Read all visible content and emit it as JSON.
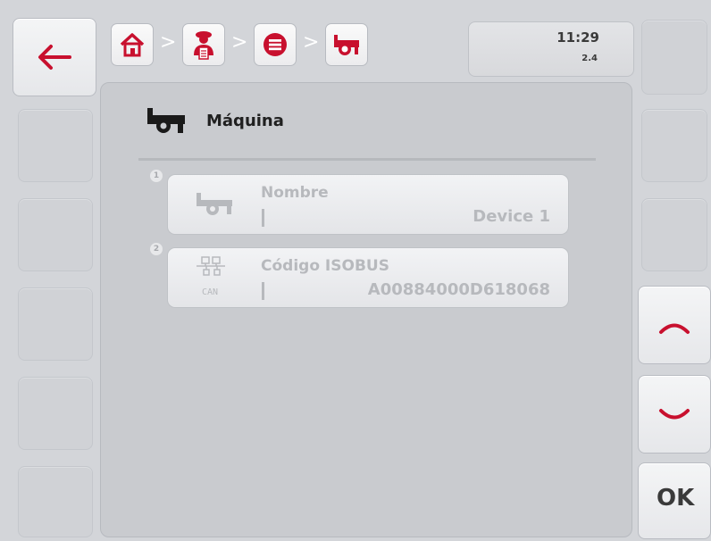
{
  "header": {
    "breadcrumbs": [
      "home-icon",
      "operator-icon",
      "list-icon",
      "machine-icon"
    ],
    "separator": ">",
    "time": "11:29",
    "version": "2.4"
  },
  "page": {
    "title": "Máquina",
    "title_icon": "machine-icon"
  },
  "fields": [
    {
      "number": "1",
      "label": "Nombre",
      "value": "Device 1",
      "icon": "machine-icon"
    },
    {
      "number": "2",
      "label": "Código ISOBUS",
      "value": "A00884000D618068",
      "icon": "can-network-icon",
      "icon_text": "CAN"
    }
  ],
  "softkeys": {
    "back": "back-arrow-icon",
    "scroll_up": "chevron-up-icon",
    "scroll_down": "chevron-down-icon",
    "ok_label": "OK"
  },
  "colors": {
    "accent_red": "#c8102e",
    "background": "#d3d5d9",
    "panel": "#c9cbcf"
  }
}
